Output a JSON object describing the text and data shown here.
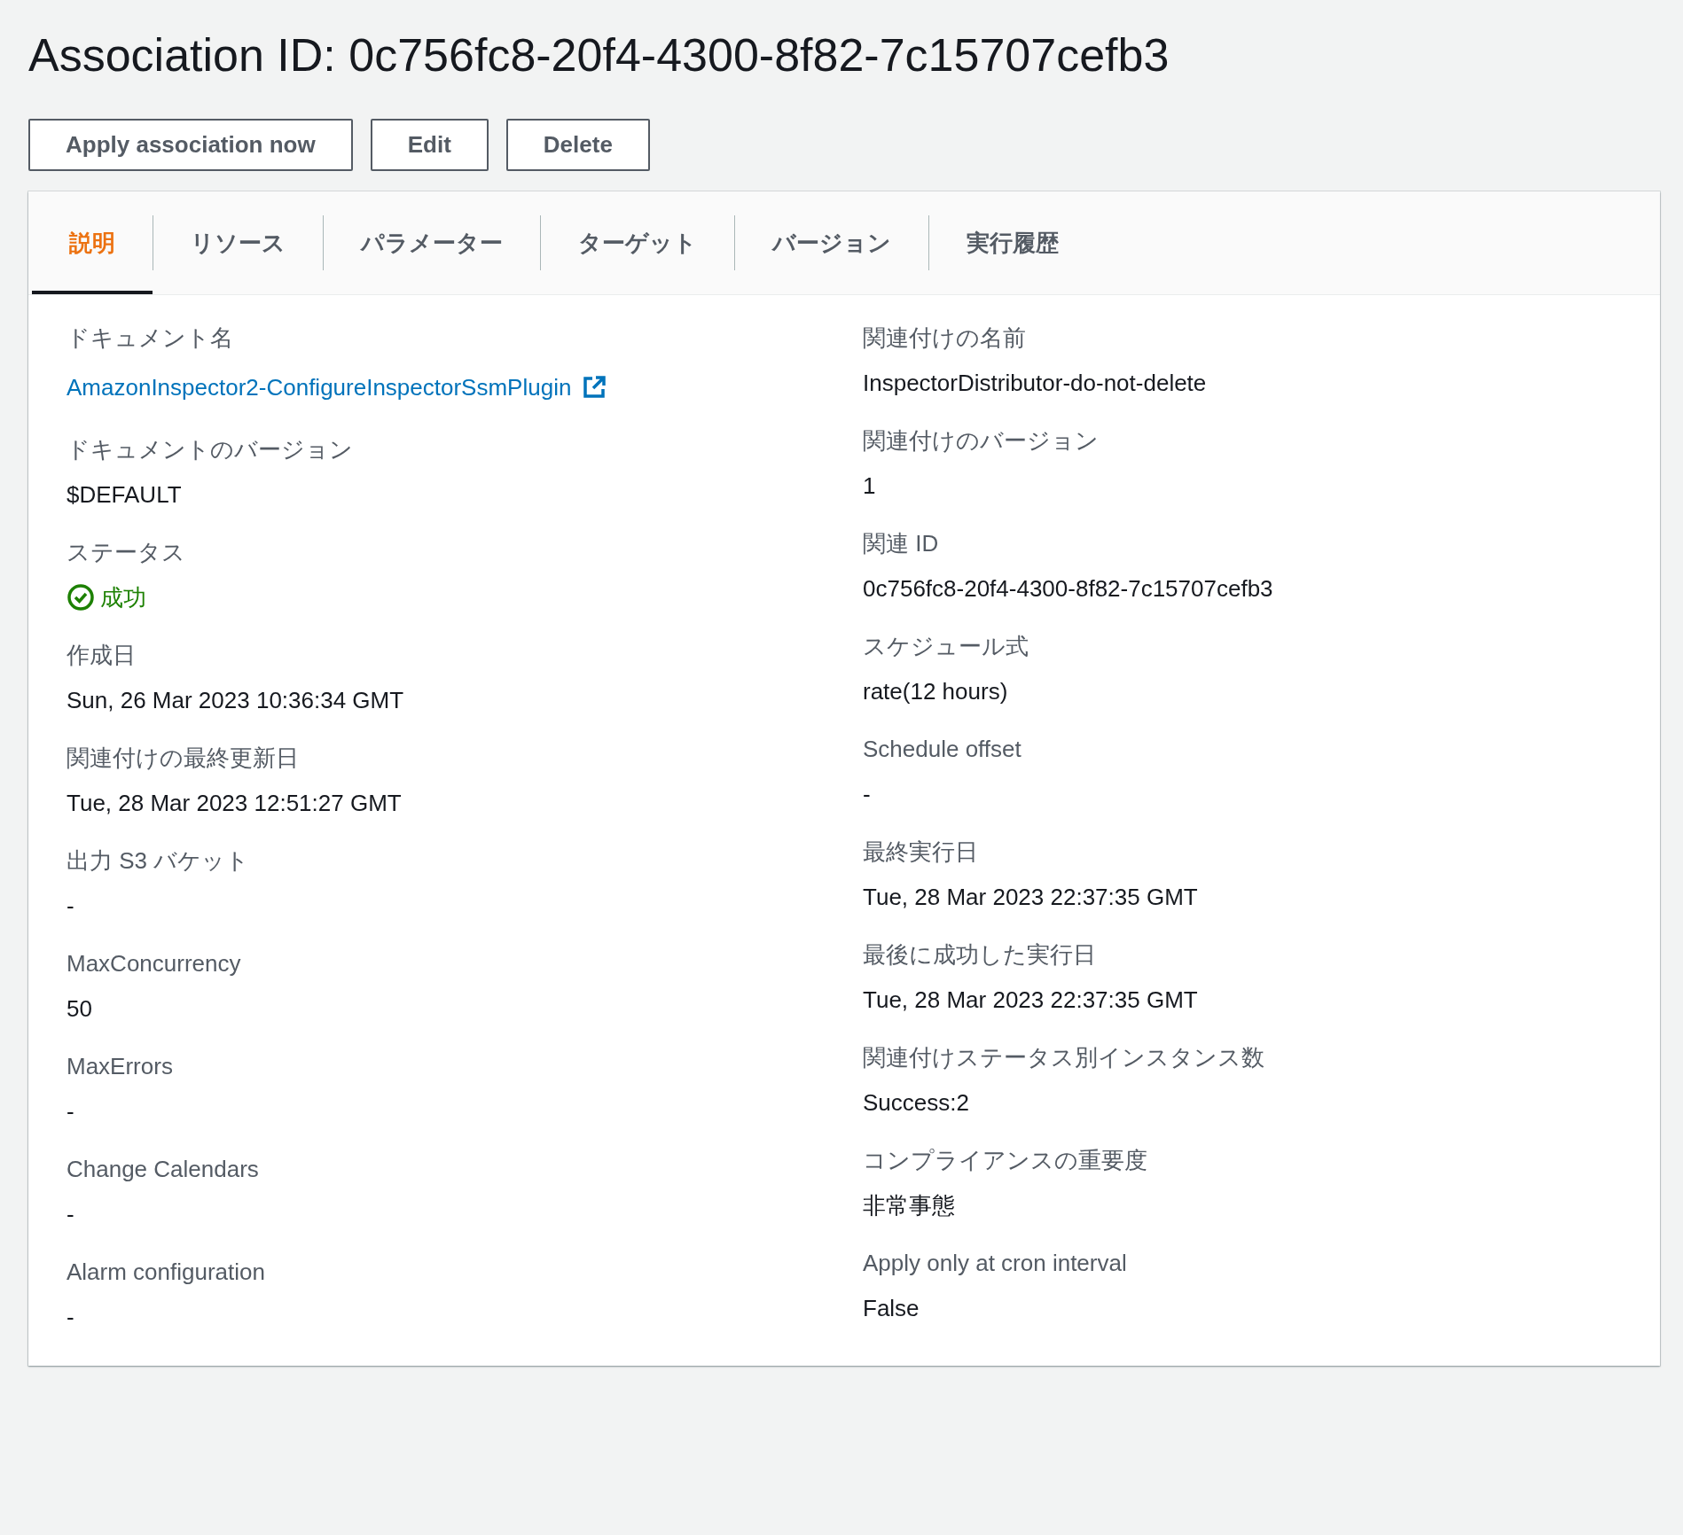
{
  "title": "Association ID: 0c756fc8-20f4-4300-8f82-7c15707cefb3",
  "buttons": [
    "Apply association now",
    "Edit",
    "Delete"
  ],
  "tabs": [
    {
      "label": "説明",
      "selected": true
    },
    {
      "label": "リソース",
      "selected": false
    },
    {
      "label": "パラメーター",
      "selected": false
    },
    {
      "label": "ターゲット",
      "selected": false
    },
    {
      "label": "バージョン",
      "selected": false
    },
    {
      "label": "実行履歴",
      "selected": false
    }
  ],
  "left_fields": [
    {
      "label": "ドキュメント名",
      "value": "AmazonInspector2-ConfigureInspectorSsmPlugin",
      "kind": "link"
    },
    {
      "label": "ドキュメントのバージョン",
      "value": "$DEFAULT",
      "kind": "text"
    },
    {
      "label": "ステータス",
      "value": "成功",
      "kind": "status"
    },
    {
      "label": "作成日",
      "value": "Sun, 26 Mar 2023 10:36:34 GMT",
      "kind": "text"
    },
    {
      "label": "関連付けの最終更新日",
      "value": "Tue, 28 Mar 2023 12:51:27 GMT",
      "kind": "text"
    },
    {
      "label": "出力 S3 バケット",
      "value": "-",
      "kind": "text"
    },
    {
      "label": "MaxConcurrency",
      "value": "50",
      "kind": "text"
    },
    {
      "label": "MaxErrors",
      "value": "-",
      "kind": "text"
    },
    {
      "label": "Change Calendars",
      "value": "-",
      "kind": "text"
    },
    {
      "label": "Alarm configuration",
      "value": "-",
      "kind": "text"
    }
  ],
  "right_fields": [
    {
      "label": "関連付けの名前",
      "value": "InspectorDistributor-do-not-delete",
      "kind": "text"
    },
    {
      "label": "関連付けのバージョン",
      "value": "1",
      "kind": "text"
    },
    {
      "label": "関連 ID",
      "value": "0c756fc8-20f4-4300-8f82-7c15707cefb3",
      "kind": "text"
    },
    {
      "label": "スケジュール式",
      "value": "rate(12 hours)",
      "kind": "text"
    },
    {
      "label": "Schedule offset",
      "value": "-",
      "kind": "text"
    },
    {
      "label": "最終実行日",
      "value": "Tue, 28 Mar 2023 22:37:35 GMT",
      "kind": "text"
    },
    {
      "label": "最後に成功した実行日",
      "value": "Tue, 28 Mar 2023 22:37:35 GMT",
      "kind": "text"
    },
    {
      "label": "関連付けステータス別インスタンス数",
      "value": "Success:2",
      "kind": "text"
    },
    {
      "label": "コンプライアンスの重要度",
      "value": "非常事態",
      "kind": "text"
    },
    {
      "label": "Apply only at cron interval",
      "value": "False",
      "kind": "text"
    }
  ]
}
